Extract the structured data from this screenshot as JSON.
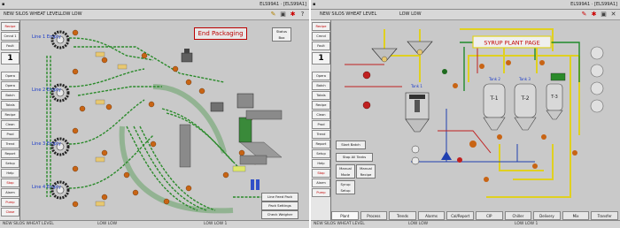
{
  "left_window": {
    "title_right": "ELS99A1 · [ELS99A1]",
    "menu": [
      "NEW SILOS WHEAT LEVEL",
      "LOW LOW"
    ],
    "toolbar_icons": [
      "wrench-icon",
      "save-icon",
      "alarm-icon",
      "question-icon"
    ],
    "sidebar": [
      "Recipe",
      "Cmnd 1",
      "Fault",
      "Opera",
      "Opera",
      "Batch",
      "Totals",
      "Recipe",
      "Clean",
      "Prod",
      "Trend",
      "Report",
      "Setup",
      "Help",
      "Stop",
      "Alarm",
      "Pump",
      "Close"
    ],
    "sidebar_number": "1",
    "sidebar_bottom": [
      "Logoff",
      "Close"
    ],
    "title_box": "End Packaging",
    "small_box": "Status Box",
    "lines": [
      "Line 1 Empty",
      "Line 2 Empty",
      "Line 3 Empty",
      "Line 4 Empty"
    ],
    "buttons": [
      "Line Feed Pack",
      "Pack Settings",
      "Check Weigher"
    ],
    "status": [
      "NEW SILOS WHEAT LEVEL",
      "LOW LOW",
      "LOW LOW 1"
    ]
  },
  "right_window": {
    "title_right": "ELS99A1 · [ELS99A1]",
    "menu": [
      "NEW SILOS WHEAT LEVEL",
      "LOW LOW"
    ],
    "toolbar_icons": [
      "wrench-icon",
      "alarm-icon",
      "save-icon",
      "close-icon"
    ],
    "sidebar": [
      "Recipe",
      "Cmnd",
      "Fault",
      "Opera",
      "Batch",
      "Totals",
      "Recipe",
      "Clean",
      "Prod",
      "Trend",
      "Report",
      "Setup",
      "Help",
      "Stop",
      "Alarm",
      "Pump"
    ],
    "sidebar_number": "1",
    "page_title": "SYRUP PLANT PAGE",
    "tanks": [
      "T-1",
      "T-2",
      "T-3"
    ],
    "tank_labels": [
      "Tank 1",
      "Tank 2",
      "Tank 3"
    ],
    "controls": [
      "Start Batch",
      "Stop All Tanks",
      "Manual Mode",
      "Manual Recipe",
      "Syrup Setup"
    ],
    "tabs": [
      "Plant",
      "Process",
      "Trends",
      "Alarms",
      "Cal/Report",
      "CIP",
      "Chiller",
      "Delivery",
      "Mix",
      "Transfer"
    ],
    "status": [
      "NEW SILOS WHEAT LEVEL",
      "LOW LOW",
      "LOW LOW 1"
    ]
  }
}
